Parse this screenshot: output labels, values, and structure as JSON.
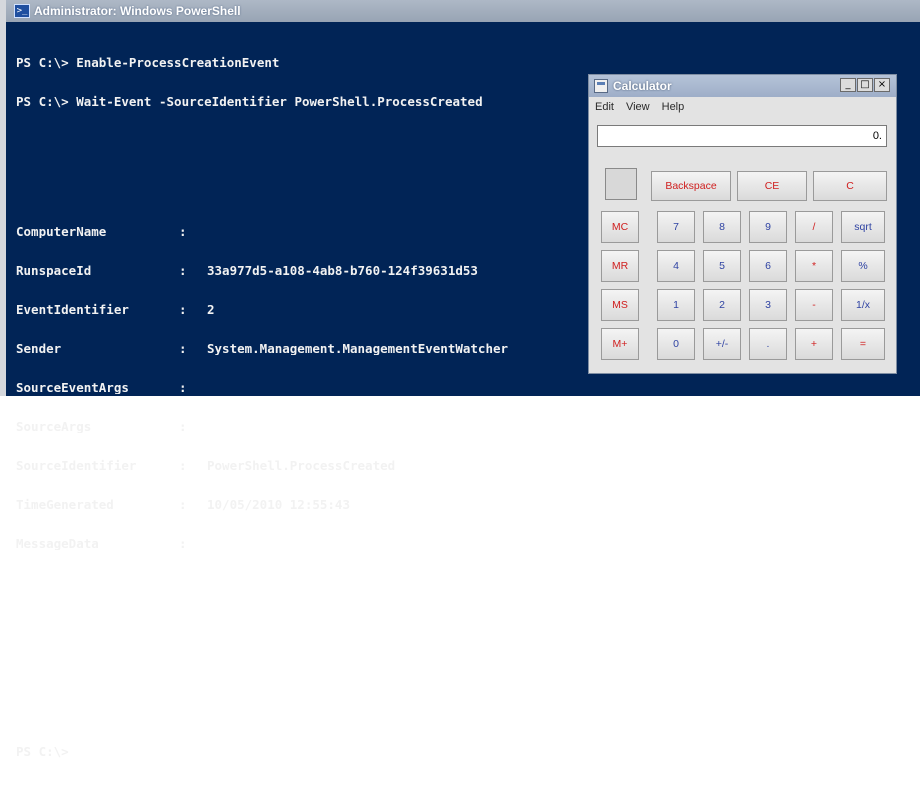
{
  "window": {
    "title": "Administrator: Windows PowerShell",
    "icon": "powershell-icon"
  },
  "console": {
    "lines": [
      "PS C:\\> Enable-ProcessCreationEvent",
      "PS C:\\> Wait-Event -SourceIdentifier PowerShell.ProcessCreated"
    ],
    "event": [
      {
        "key": "ComputerName",
        "sep": ":",
        "value": ""
      },
      {
        "key": "RunspaceId",
        "sep": ":",
        "value": "33a977d5-a108-4ab8-b760-124f39631d53"
      },
      {
        "key": "EventIdentifier",
        "sep": ":",
        "value": "2"
      },
      {
        "key": "Sender",
        "sep": ":",
        "value": "System.Management.ManagementEventWatcher"
      },
      {
        "key": "SourceEventArgs",
        "sep": ":",
        "value": ""
      },
      {
        "key": "SourceArgs",
        "sep": ":",
        "value": ""
      },
      {
        "key": "SourceIdentifier",
        "sep": ":",
        "value": "PowerShell.ProcessCreated"
      },
      {
        "key": "TimeGenerated",
        "sep": ":",
        "value": "10/05/2010 12:55:43"
      },
      {
        "key": "MessageData",
        "sep": ":",
        "value": ""
      }
    ],
    "prompt": "PS C:\\>"
  },
  "calculator": {
    "title": "Calculator",
    "window_buttons": {
      "minimize": "_",
      "maximize": "□",
      "close": "×"
    },
    "menu": [
      "Edit",
      "View",
      "Help"
    ],
    "display": "0.",
    "buttons": {
      "backspace": "Backspace",
      "ce": "CE",
      "c": "C",
      "mc": "MC",
      "mr": "MR",
      "ms": "MS",
      "mplus": "M+",
      "n7": "7",
      "n8": "8",
      "n9": "9",
      "div": "/",
      "sqrt": "sqrt",
      "n4": "4",
      "n5": "5",
      "n6": "6",
      "mul": "*",
      "pct": "%",
      "n1": "1",
      "n2": "2",
      "n3": "3",
      "sub": "-",
      "recip": "1/x",
      "n0": "0",
      "sign": "+/-",
      "dot": ".",
      "add": "+",
      "eq": "="
    }
  },
  "colors": {
    "console_bg": "#012456",
    "console_text": "#f2f2f2",
    "calc_red": "#d02020",
    "calc_blue": "#2f43a3"
  }
}
